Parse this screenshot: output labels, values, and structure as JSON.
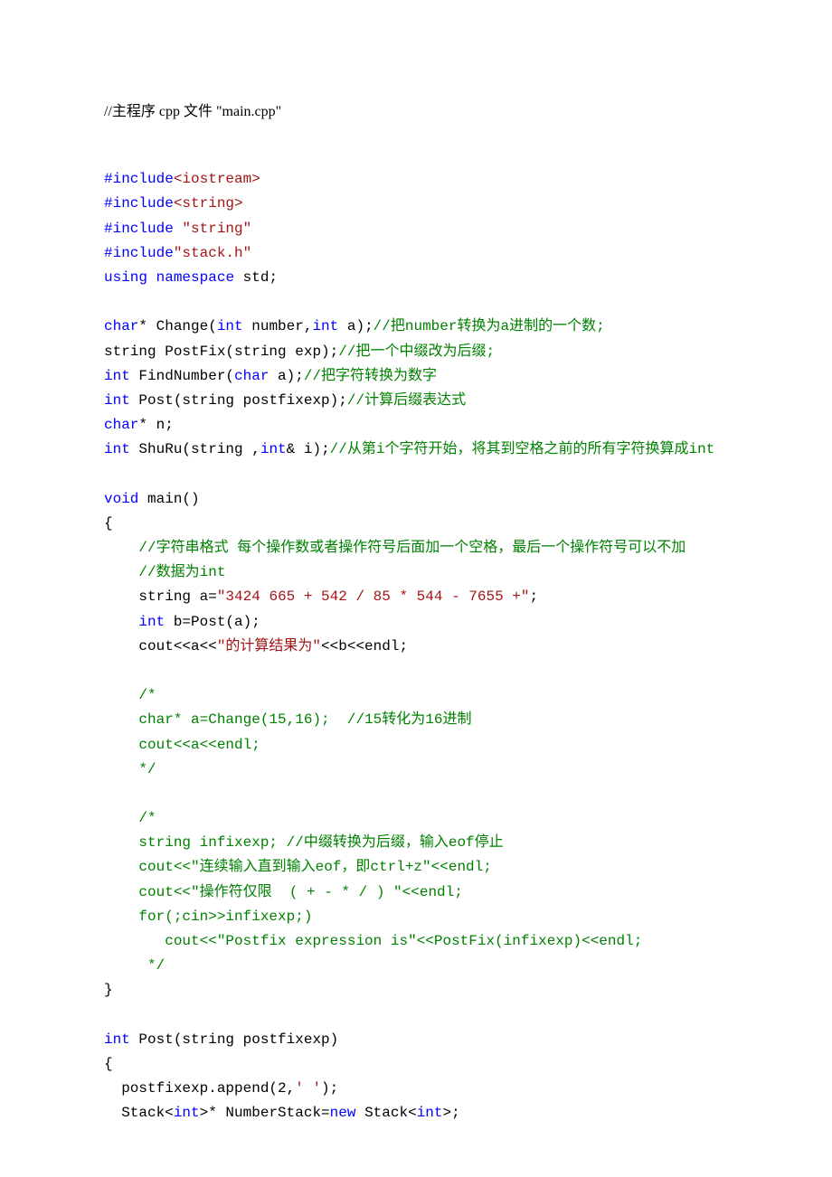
{
  "header": "//主程序 cpp 文件 \"main.cpp\"",
  "lines": [
    [
      {
        "t": "#include",
        "c": "blue"
      },
      {
        "t": "<iostream>",
        "c": "red"
      }
    ],
    [
      {
        "t": "#include",
        "c": "blue"
      },
      {
        "t": "<string>",
        "c": "red"
      }
    ],
    [
      {
        "t": "#include",
        "c": "blue"
      },
      {
        "t": " "
      },
      {
        "t": "\"string\"",
        "c": "red"
      }
    ],
    [
      {
        "t": "#include",
        "c": "blue"
      },
      {
        "t": "\"stack.h\"",
        "c": "red"
      }
    ],
    [
      {
        "t": "using",
        "c": "blue"
      },
      {
        "t": " "
      },
      {
        "t": "namespace",
        "c": "blue"
      },
      {
        "t": " std;"
      }
    ],
    [],
    [
      {
        "t": "char",
        "c": "blue"
      },
      {
        "t": "* Change("
      },
      {
        "t": "int",
        "c": "blue"
      },
      {
        "t": " number,"
      },
      {
        "t": "int",
        "c": "blue"
      },
      {
        "t": " a);"
      },
      {
        "t": "//把number转换为a进制的一个数;",
        "c": "green"
      }
    ],
    [
      {
        "t": "string PostFix(string exp);"
      },
      {
        "t": "//把一个中缀改为后缀;",
        "c": "green"
      }
    ],
    [
      {
        "t": "int",
        "c": "blue"
      },
      {
        "t": " FindNumber("
      },
      {
        "t": "char",
        "c": "blue"
      },
      {
        "t": " a);"
      },
      {
        "t": "//把字符转换为数字",
        "c": "green"
      }
    ],
    [
      {
        "t": "int",
        "c": "blue"
      },
      {
        "t": " Post(string postfixexp);"
      },
      {
        "t": "//计算后缀表达式",
        "c": "green"
      }
    ],
    [
      {
        "t": "char",
        "c": "blue"
      },
      {
        "t": "* n;"
      }
    ],
    [
      {
        "t": "int",
        "c": "blue"
      },
      {
        "t": " ShuRu(string ,"
      },
      {
        "t": "int",
        "c": "blue"
      },
      {
        "t": "& i);"
      },
      {
        "t": "//从第i个字符开始，将其到空格之前的所有字符换算成int",
        "c": "green"
      }
    ],
    [],
    [
      {
        "t": "void",
        "c": "blue"
      },
      {
        "t": " main()"
      }
    ],
    [
      {
        "t": "{"
      }
    ],
    [
      {
        "t": "    "
      },
      {
        "t": "//字符串格式 每个操作数或者操作符号后面加一个空格，最后一个操作符号可以不加",
        "c": "green"
      }
    ],
    [
      {
        "t": "    "
      },
      {
        "t": "//数据为int",
        "c": "green"
      }
    ],
    [
      {
        "t": "    string a="
      },
      {
        "t": "\"3424 665 + 542 / 85 * 544 - 7655 +\"",
        "c": "red"
      },
      {
        "t": ";"
      }
    ],
    [
      {
        "t": "    "
      },
      {
        "t": "int",
        "c": "blue"
      },
      {
        "t": " b=Post(a);"
      }
    ],
    [
      {
        "t": "    cout<<a<<"
      },
      {
        "t": "\"的计算结果为\"",
        "c": "red"
      },
      {
        "t": "<<b<<endl;"
      }
    ],
    [],
    [
      {
        "t": "    "
      },
      {
        "t": "/*",
        "c": "green"
      }
    ],
    [
      {
        "t": "    char* a=Change(15,16);  //15转化为16进制",
        "c": "green"
      }
    ],
    [
      {
        "t": "    cout<<a<<endl;",
        "c": "green"
      }
    ],
    [
      {
        "t": "    */",
        "c": "green"
      }
    ],
    [],
    [
      {
        "t": "    "
      },
      {
        "t": "/*",
        "c": "green"
      }
    ],
    [
      {
        "t": "    string infixexp; //中缀转换为后缀，输入eof停止",
        "c": "green"
      }
    ],
    [
      {
        "t": "    cout<<\"连续输入直到输入eof，即ctrl+z\"<<endl;",
        "c": "green"
      }
    ],
    [
      {
        "t": "    cout<<\"操作符仅限  ( + - * / ) \"<<endl;",
        "c": "green"
      }
    ],
    [
      {
        "t": "    for(;cin>>infixexp;)",
        "c": "green"
      }
    ],
    [
      {
        "t": "       cout<<\"Postfix expression is\"<<PostFix(infixexp)<<endl;",
        "c": "green"
      }
    ],
    [
      {
        "t": "     */",
        "c": "green"
      }
    ],
    [
      {
        "t": "}"
      }
    ],
    [],
    [
      {
        "t": "int",
        "c": "blue"
      },
      {
        "t": " Post(string postfixexp)"
      }
    ],
    [
      {
        "t": "{"
      }
    ],
    [
      {
        "t": "  postfixexp.append(2,"
      },
      {
        "t": "' '",
        "c": "red"
      },
      {
        "t": ");"
      }
    ],
    [
      {
        "t": "  Stack<"
      },
      {
        "t": "int",
        "c": "blue"
      },
      {
        "t": ">* NumberStack="
      },
      {
        "t": "new",
        "c": "blue"
      },
      {
        "t": " Stack<"
      },
      {
        "t": "int",
        "c": "blue"
      },
      {
        "t": ">;"
      }
    ]
  ]
}
